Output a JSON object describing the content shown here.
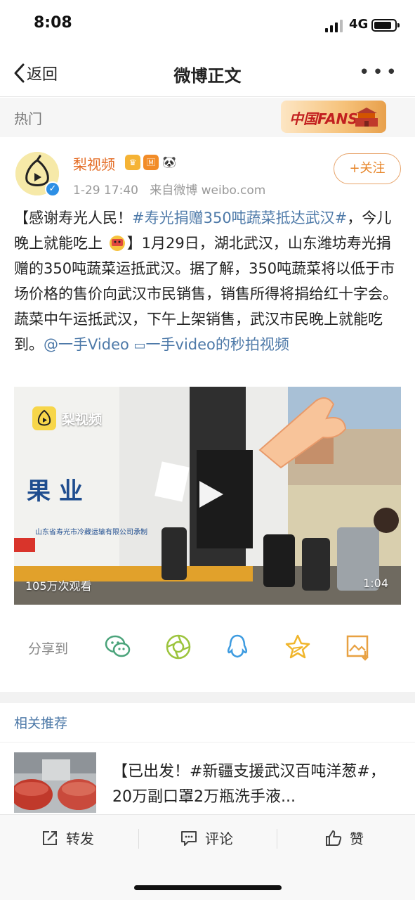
{
  "status_bar": {
    "time": "8:08",
    "network": "4G"
  },
  "nav": {
    "back_label": "返回",
    "title": "微博正文",
    "more_label": "•••"
  },
  "hot_bar": {
    "label": "热门",
    "badge_text": "中国FANS"
  },
  "post": {
    "username": "梨视频",
    "timestamp": "1-29 17:40",
    "source": "来自微博 weibo.com",
    "follow_label": "+关注",
    "text": {
      "p1": "【感谢寿光人民！",
      "tag1": "#寿光捐赠350吨蔬菜抵达武汉#",
      "p2": "，今儿晚上就能吃上",
      "p3": "】1月29日，湖北武汉，山东潍坊寿光捐赠的350吨蔬菜运抵武汉。据了解，350吨蔬菜将以低于市场价格的售价向武汉市民销售，销售所得将捐给红十字会。蔬菜中午运抵武汉，下午上架销售，武汉市民晚上就能吃到。",
      "mention": "@一手Video",
      "video_link": "一手video的秒拍视频"
    },
    "video": {
      "logo_text": "梨视频",
      "views": "105万次观看",
      "duration": "1:04",
      "truck_text_left": "果 业",
      "truck_text_small": "山东省寿光市冷藏运输有限公司承制"
    }
  },
  "share": {
    "label": "分享到",
    "icons": [
      "wechat-icon",
      "moments-icon",
      "qq-icon",
      "qzone-star-icon",
      "save-image-icon"
    ]
  },
  "related": {
    "title": "相关推荐",
    "item_text": "【已出发！#新疆支援武汉百吨洋葱#，20万副口罩2万瓶洗手液..."
  },
  "bottom_bar": {
    "repost_label": "转发",
    "comment_label": "评论",
    "like_label": "赞"
  },
  "colors": {
    "accent_orange": "#e36a22",
    "link_blue": "#4d79a8",
    "muted": "#999999"
  }
}
